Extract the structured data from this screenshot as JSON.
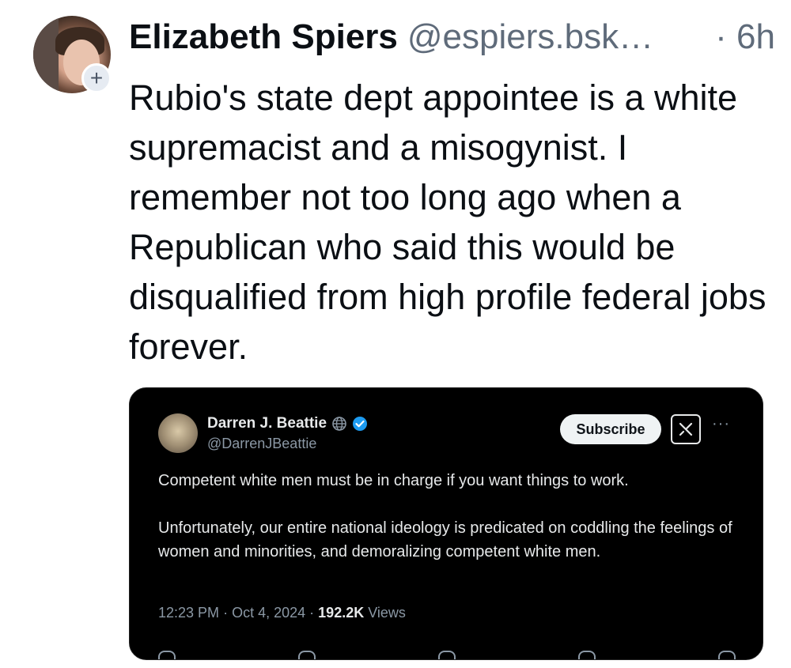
{
  "post": {
    "author": {
      "display_name": "Elizabeth Spiers",
      "handle": "@espiers.bsk…",
      "time": "· 6h",
      "follow_symbol": "+"
    },
    "text": "Rubio's state dept appointee is a white supremacist and a misogynist. I remember not too long ago when a Republican who said this would be disqualified from high profile federal jobs forever."
  },
  "embed": {
    "author": {
      "display_name": "Darren J. Beattie",
      "handle": "@DarrenJBeattie"
    },
    "subscribe_label": "Subscribe",
    "more_label": "···",
    "paragraphs": [
      "Competent white men must be in charge if you want things to work.",
      "Unfortunately, our entire national ideology is predicated on coddling the feelings of women and minorities, and demoralizing competent white men."
    ],
    "meta": {
      "time": "12:23 PM",
      "date": "Oct 4, 2024",
      "separator": "·",
      "views_count": "192.2K",
      "views_label": "Views"
    },
    "icons": [
      "globe-icon",
      "verified-badge-icon",
      "grok-icon",
      "reply-icon",
      "repost-icon",
      "like-icon",
      "bookmark-icon",
      "share-icon"
    ]
  },
  "colors": {
    "verified": "#1d9bf0",
    "embed_bg": "#000000",
    "muted_text": "#5f6b7a"
  }
}
